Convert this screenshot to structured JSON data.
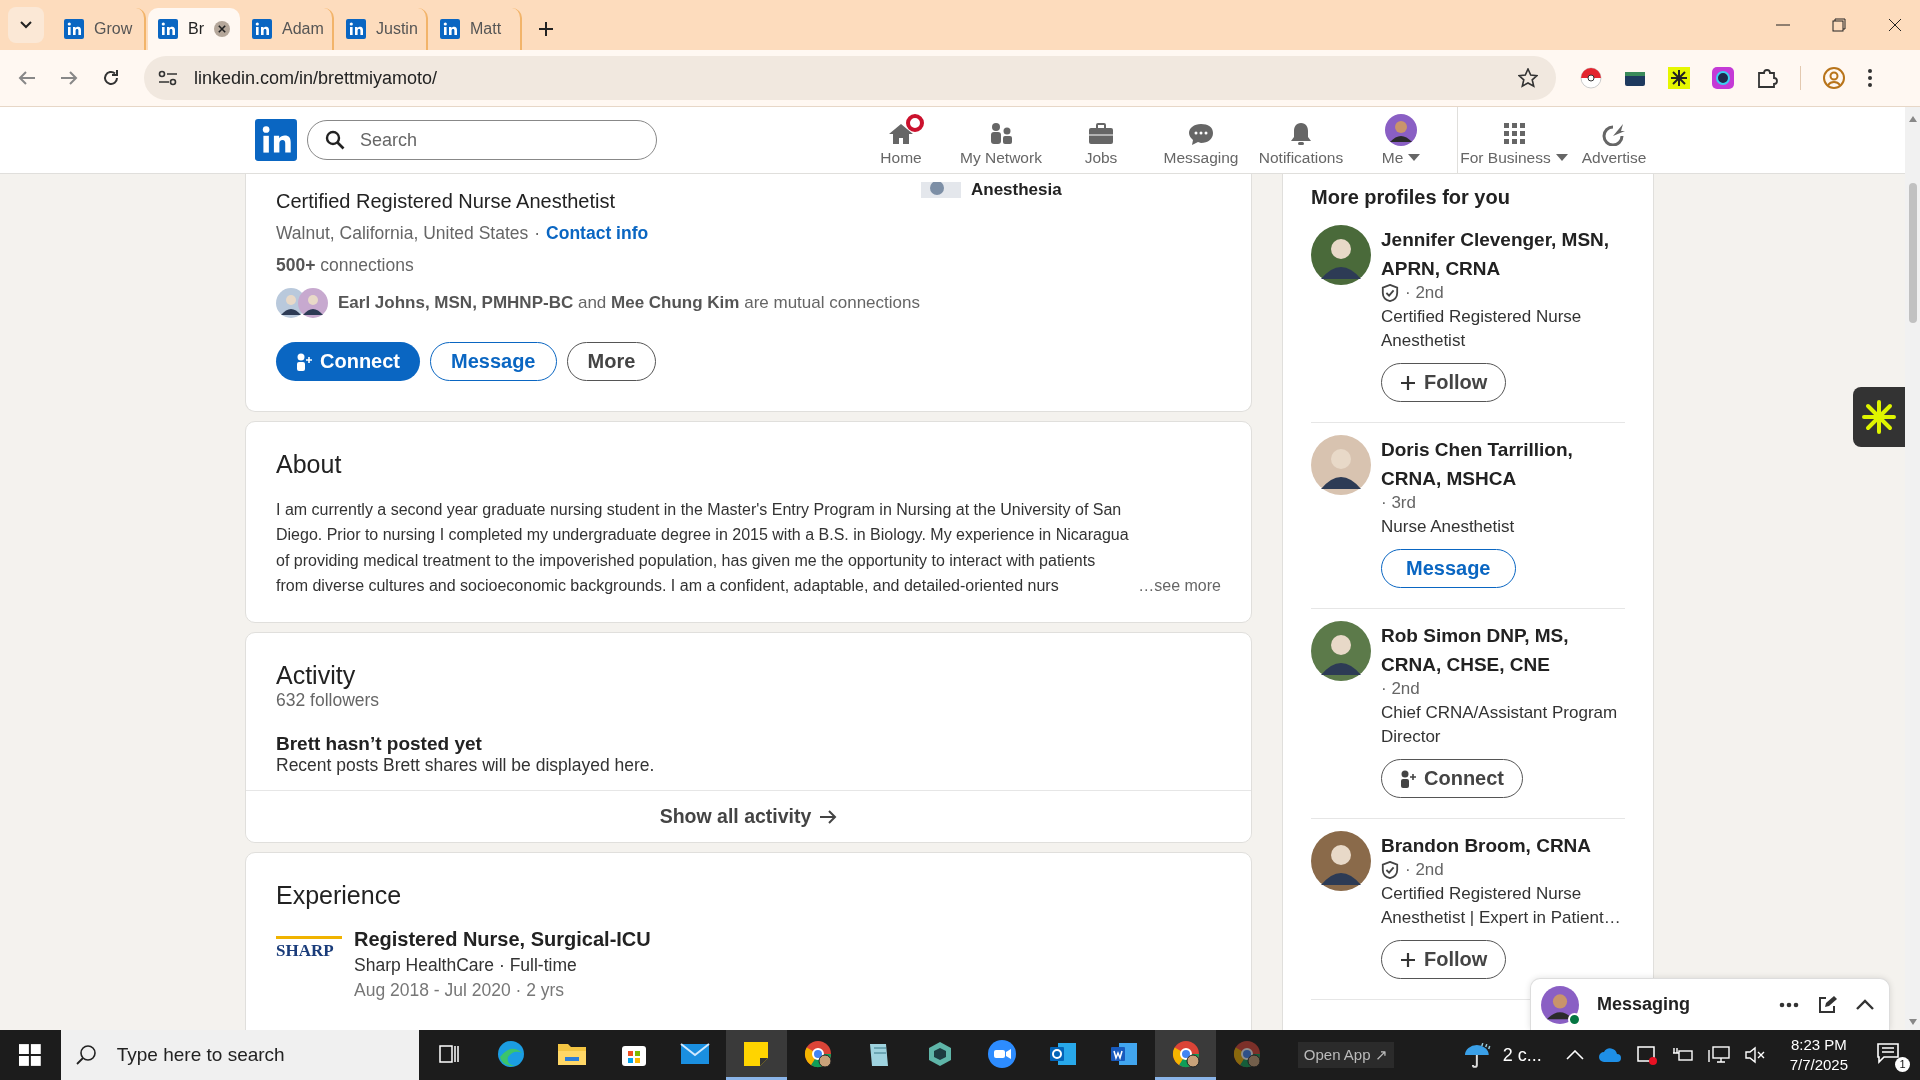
{
  "browser": {
    "tabs": [
      {
        "title": "Grow",
        "selected": false,
        "closable": false
      },
      {
        "title": "Br",
        "selected": true,
        "closable": true
      },
      {
        "title": "Adam",
        "selected": false,
        "closable": false
      },
      {
        "title": "Justin",
        "selected": false,
        "closable": false
      },
      {
        "title": "Matt",
        "selected": false,
        "closable": false
      }
    ],
    "url": "linkedin.com/in/brettmiyamoto/"
  },
  "nav": {
    "search_placeholder": "Search",
    "items": [
      {
        "kind": "home",
        "label": "Home",
        "notification": true,
        "caret": false
      },
      {
        "kind": "network",
        "label": "My Network",
        "notification": false,
        "caret": false
      },
      {
        "kind": "jobs",
        "label": "Jobs",
        "notification": false,
        "caret": false
      },
      {
        "kind": "messaging",
        "label": "Messaging",
        "notification": false,
        "caret": false
      },
      {
        "kind": "notifications",
        "label": "Notifications",
        "notification": false,
        "caret": false
      },
      {
        "kind": "me",
        "label": "Me",
        "notification": false,
        "caret": true
      },
      {
        "kind": "business",
        "label": "For Business",
        "notification": false,
        "caret": true
      },
      {
        "kind": "advertise",
        "label": "Advertise",
        "notification": false,
        "caret": false
      }
    ]
  },
  "profile": {
    "headline": "Certified Registered Nurse Anesthetist",
    "location": "Walnut, California, United States",
    "separator": "·",
    "contact_link": "Contact info",
    "connections": "**500+** connections",
    "mutual": "**Earl Johns, MSN, PMHNP-BC** and **Mee Chung Kim** are mutual connections",
    "education": "Anesthesia",
    "actions": [
      {
        "label": "Connect",
        "kind": "primary"
      },
      {
        "label": "Message",
        "kind": "outline"
      },
      {
        "label": "More",
        "kind": "neutral"
      }
    ]
  },
  "about": {
    "title": "About",
    "text": "I am currently a second year graduate nursing student in the Master's Entry Program in Nursing at the University of San Diego. Prior to nursing I completed my undergraduate degree in 2015 with a B.S. in Biology. My experience in Nicaragua of providing medical treatment to the impoverished population, has given me the opportunity to interact with patients from diverse cultures and socioeconomic backgrounds. I am a confident, adaptable, and detailed-oriented nurs",
    "see_more": "…see more"
  },
  "activity": {
    "title": "Activity",
    "followers": "632 followers",
    "empty_title": "Brett hasn’t posted yet",
    "empty_text": "Recent posts Brett shares will be displayed here.",
    "show_all": "Show all activity"
  },
  "experience": {
    "title": "Experience",
    "items": [
      {
        "logo": "SHARP",
        "title": "Registered Nurse, Surgical-ICU",
        "company": "Sharp HealthCare · Full-time",
        "dates": "Aug 2018 - Jul 2020 · 2 yrs"
      }
    ]
  },
  "sidebar": {
    "title": "More profiles for you",
    "profiles": [
      {
        "name": "Jennifer Clevenger, MSN, APRN, CRNA",
        "verified": true,
        "degree": "· 2nd",
        "headline": "Certified Registered Nurse Anesthetist",
        "action": {
          "label": "Follow",
          "kind": "follow"
        }
      },
      {
        "name": "Doris Chen Tarrillion, CRNA, MSHCA",
        "verified": false,
        "degree": "· 3rd",
        "headline": "Nurse Anesthetist",
        "action": {
          "label": "Message",
          "kind": "message"
        }
      },
      {
        "name": "Rob Simon DNP, MS, CRNA, CHSE, CNE",
        "verified": false,
        "degree": "· 2nd",
        "headline": "Chief CRNA/Assistant Program Director",
        "action": {
          "label": "Connect",
          "kind": "connect"
        }
      },
      {
        "name": "Brandon Broom, CRNA",
        "verified": true,
        "degree": "· 2nd",
        "headline": "Certified Registered Nurse Anesthetist | Expert in Patient…",
        "action": {
          "label": "Follow",
          "kind": "follow"
        }
      }
    ]
  },
  "messaging": {
    "title": "Messaging",
    "online": true
  },
  "taskbar": {
    "search_placeholder": "Type here to search",
    "apps": [
      {
        "kind": "taskview",
        "active": false
      },
      {
        "kind": "edge",
        "active": false
      },
      {
        "kind": "explorer",
        "active": false
      },
      {
        "kind": "store",
        "active": false
      },
      {
        "kind": "mail",
        "active": false
      },
      {
        "kind": "notes",
        "active": true
      },
      {
        "kind": "chrome",
        "active": false
      },
      {
        "kind": "pad",
        "active": false
      },
      {
        "kind": "hexagon",
        "active": false
      },
      {
        "kind": "zoom",
        "active": false
      },
      {
        "kind": "outlook",
        "active": false
      },
      {
        "kind": "word",
        "active": false
      },
      {
        "kind": "chrome",
        "active": true
      },
      {
        "kind": "chrome-dim",
        "active": false
      }
    ],
    "open_app": "Open App ↗",
    "weather": "2 c...",
    "time": "8:23 PM",
    "date": "7/7/2025",
    "notifications": "1"
  }
}
